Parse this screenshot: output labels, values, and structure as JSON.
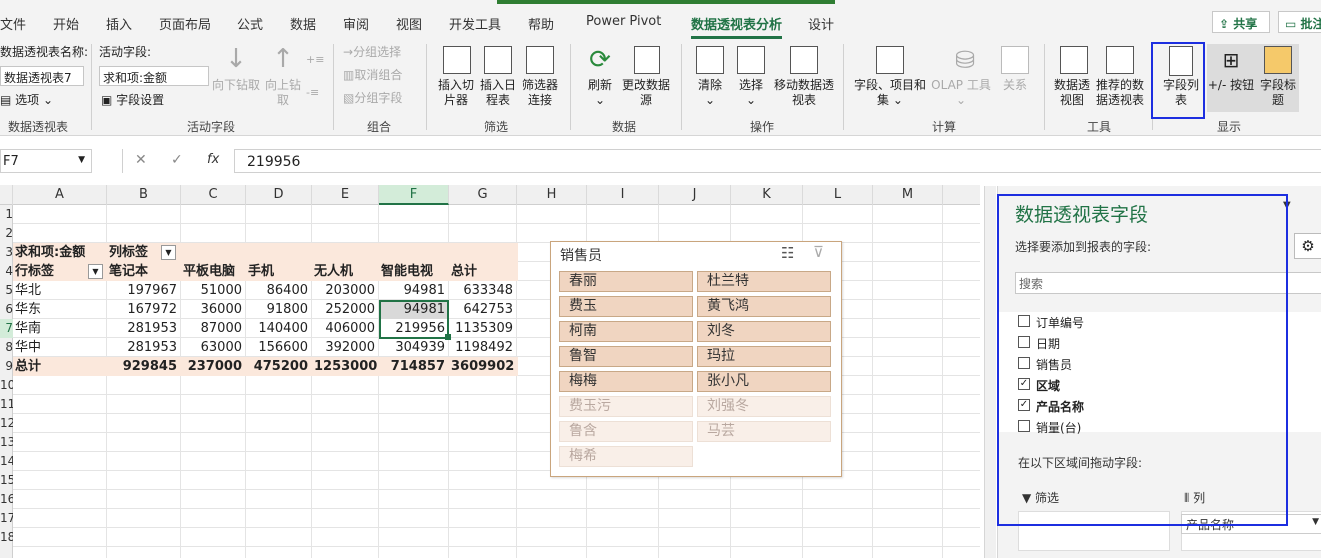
{
  "menu": {
    "tabs": [
      "文件",
      "开始",
      "插入",
      "页面布局",
      "公式",
      "数据",
      "审阅",
      "视图",
      "开发工具",
      "帮助",
      "Power Pivot",
      "数据透视表分析",
      "设计"
    ],
    "active_tab": "数据透视表分析",
    "share": "共享",
    "comment": "批注"
  },
  "ribbon": {
    "pivot": {
      "name_label": "数据透视表名称:",
      "name_value": "数据透视表7",
      "options": "选项",
      "group": "数据透视表"
    },
    "active_field": {
      "label": "活动字段:",
      "value": "求和项:金额",
      "settings": "字段设置",
      "drill_down": "向下钻取",
      "drill_up": "向上钻取",
      "group": "活动字段"
    },
    "group_grp": {
      "group_sel": "分组选择",
      "ungroup": "取消组合",
      "group_field": "分组字段",
      "group": "组合"
    },
    "filter": {
      "slicer": "插入切片器",
      "timeline": "插入日程表",
      "connections": "筛选器连接",
      "group": "筛选"
    },
    "data": {
      "refresh": "刷新",
      "change_source": "更改数据源",
      "group": "数据"
    },
    "actions": {
      "clear": "清除",
      "select": "选择",
      "move": "移动数据透视表",
      "group": "操作"
    },
    "calc": {
      "fields_items": "字段、项目和集",
      "olap": "OLAP 工具",
      "relations": "关系",
      "group": "计算"
    },
    "tools": {
      "pivotchart": "数据透视图",
      "recommended": "推荐的数据透视表",
      "group": "工具"
    },
    "show": {
      "field_list": "字段列表",
      "buttons": "+/- 按钮",
      "headers": "字段标题",
      "group": "显示"
    }
  },
  "formula_bar": {
    "cell_ref": "F7",
    "fx": "fx",
    "value": "219956"
  },
  "columns": [
    "A",
    "B",
    "C",
    "D",
    "E",
    "F",
    "G",
    "H",
    "I",
    "J",
    "K",
    "L",
    "M"
  ],
  "selected_column": "F",
  "rows": [
    "1",
    "2",
    "3",
    "4",
    "5",
    "6",
    "7",
    "8",
    "9",
    "10",
    "11",
    "12",
    "13",
    "14",
    "15",
    "16",
    "17",
    "18"
  ],
  "selected_row": "7",
  "pivot": {
    "title": "求和项:金额",
    "col_label": "列标签",
    "row_label": "行标签",
    "headers": [
      "笔记本",
      "平板电脑",
      "手机",
      "无人机",
      "智能电视",
      "总计"
    ],
    "data": [
      {
        "region": "华北",
        "values": [
          "197967",
          "51000",
          "86400",
          "203000",
          "94981",
          "633348"
        ]
      },
      {
        "region": "华东",
        "values": [
          "167972",
          "36000",
          "91800",
          "252000",
          "94981",
          "642753"
        ]
      },
      {
        "region": "华南",
        "values": [
          "281953",
          "87000",
          "140400",
          "406000",
          "219956",
          "1135309"
        ]
      },
      {
        "region": "华中",
        "values": [
          "281953",
          "63000",
          "156600",
          "392000",
          "304939",
          "1198492"
        ]
      }
    ],
    "total": {
      "label": "总计",
      "values": [
        "929845",
        "237000",
        "475200",
        "1253000",
        "714857",
        "3609902"
      ]
    }
  },
  "slicer": {
    "title": "销售员",
    "items": [
      {
        "label": "春丽",
        "on": true
      },
      {
        "label": "杜兰特",
        "on": true
      },
      {
        "label": "费玉",
        "on": true
      },
      {
        "label": "黄飞鸿",
        "on": true
      },
      {
        "label": "柯南",
        "on": true
      },
      {
        "label": "刘冬",
        "on": true
      },
      {
        "label": "鲁智",
        "on": true
      },
      {
        "label": "玛拉",
        "on": true
      },
      {
        "label": "梅梅",
        "on": true
      },
      {
        "label": "张小凡",
        "on": true
      },
      {
        "label": "费玉污",
        "on": false
      },
      {
        "label": "刘强冬",
        "on": false
      },
      {
        "label": "鲁含",
        "on": false
      },
      {
        "label": "马芸",
        "on": false
      },
      {
        "label": "梅希",
        "on": false
      }
    ]
  },
  "field_pane": {
    "title": "数据透视表字段",
    "subtitle": "选择要添加到报表的字段:",
    "search_placeholder": "搜索",
    "fields": [
      {
        "label": "订单编号",
        "checked": false
      },
      {
        "label": "日期",
        "checked": false
      },
      {
        "label": "销售员",
        "checked": false
      },
      {
        "label": "区域",
        "checked": true
      },
      {
        "label": "产品名称",
        "checked": true
      },
      {
        "label": "销量(台)",
        "checked": false
      }
    ],
    "drag_hint": "在以下区域间拖动字段:",
    "filter_area": "筛选",
    "column_area": "列",
    "column_value": "产品名称"
  }
}
